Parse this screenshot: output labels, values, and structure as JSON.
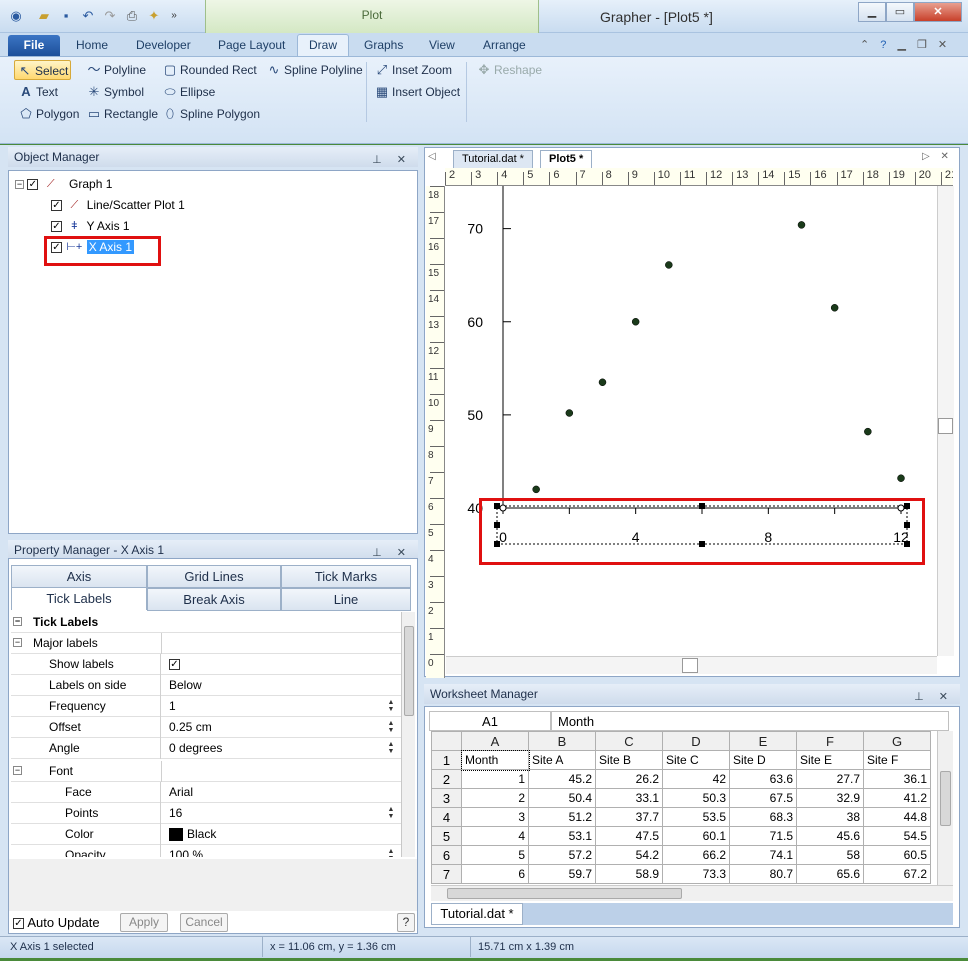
{
  "window": {
    "title": "Grapher - [Plot5 *]",
    "context_tab_group": "Plot"
  },
  "ribbon": {
    "tabs": [
      "File",
      "Home",
      "Developer",
      "Page Layout",
      "Draw",
      "Graphs",
      "View",
      "Arrange"
    ],
    "active_tab": "Draw",
    "draw_buttons": {
      "select": "Select",
      "polyline": "Polyline",
      "rounded_rect": "Rounded Rect",
      "spline_polyline": "Spline Polyline",
      "text": "Text",
      "symbol": "Symbol",
      "ellipse": "Ellipse",
      "polygon": "Polygon",
      "rectangle": "Rectangle",
      "spline_polygon": "Spline Polygon",
      "inset_zoom": "Inset Zoom",
      "insert_object": "Insert Object",
      "reshape": "Reshape"
    }
  },
  "object_manager": {
    "title": "Object Manager",
    "items": {
      "graph": "Graph 1",
      "plot": "Line/Scatter Plot 1",
      "yaxis": "Y Axis 1",
      "xaxis": "X Axis 1"
    }
  },
  "property_manager": {
    "title": "Property Manager - X Axis 1",
    "tabs_row1": [
      "Axis",
      "Grid Lines",
      "Tick Marks"
    ],
    "tabs_row2": [
      "Tick Labels",
      "Break Axis",
      "Line"
    ],
    "active_tab": "Tick Labels",
    "section": "Tick Labels",
    "major_labels": "Major labels",
    "rows": [
      {
        "label": "Show labels",
        "value": ""
      },
      {
        "label": "Labels on side",
        "value": "Below"
      },
      {
        "label": "Frequency",
        "value": "1"
      },
      {
        "label": "Offset",
        "value": "0.25 cm"
      },
      {
        "label": "Angle",
        "value": "0 degrees"
      }
    ],
    "font_section": "Font",
    "font_rows": [
      {
        "label": "Face",
        "value": "Arial"
      },
      {
        "label": "Points",
        "value": "16"
      },
      {
        "label": "Color",
        "value": "Black"
      },
      {
        "label": "Opacity",
        "value": "100 %"
      }
    ],
    "auto_update": "Auto Update",
    "apply": "Apply",
    "cancel": "Cancel",
    "help": "?"
  },
  "doc_tabs": [
    "Tutorial.dat *",
    "Plot5 *"
  ],
  "rulers": {
    "horizontal": [
      "2",
      "3",
      "4",
      "5",
      "6",
      "7",
      "8",
      "9",
      "10",
      "11",
      "12",
      "13",
      "14",
      "15",
      "16",
      "17",
      "18",
      "19",
      "20",
      "21"
    ],
    "vertical": [
      "18",
      "17",
      "16",
      "15",
      "14",
      "13",
      "12",
      "11",
      "10",
      "9",
      "8",
      "7",
      "6",
      "5",
      "4",
      "3",
      "2",
      "1",
      "0"
    ]
  },
  "chart_data": {
    "type": "scatter",
    "title": "",
    "xlabel": "",
    "ylabel": "",
    "xlim": [
      0,
      12
    ],
    "ylim": [
      40,
      72
    ],
    "x_ticks": [
      0,
      4,
      8,
      12
    ],
    "y_ticks": [
      70,
      60,
      50,
      40
    ],
    "series": [
      {
        "x": [
          1,
          2,
          3,
          4,
          5,
          9,
          10,
          11,
          12
        ],
        "y": [
          42,
          50.2,
          53.5,
          60,
          66.1,
          70.4,
          61.5,
          48.2,
          43.2
        ]
      }
    ],
    "marker_color": "#1a3a1a"
  },
  "worksheet": {
    "title": "Worksheet Manager",
    "cell_ref": "A1",
    "cell_value": "Month",
    "columns": [
      "A",
      "B",
      "C",
      "D",
      "E",
      "F",
      "G"
    ],
    "rows": [
      {
        "n": "1",
        "cells": [
          "Month",
          "Site A",
          "Site B",
          "Site C",
          "Site D",
          "Site E",
          "Site F"
        ]
      },
      {
        "n": "2",
        "cells": [
          "1",
          "45.2",
          "26.2",
          "42",
          "63.6",
          "27.7",
          "36.1"
        ]
      },
      {
        "n": "3",
        "cells": [
          "2",
          "50.4",
          "33.1",
          "50.3",
          "67.5",
          "32.9",
          "41.2"
        ]
      },
      {
        "n": "4",
        "cells": [
          "3",
          "51.2",
          "37.7",
          "53.5",
          "68.3",
          "38",
          "44.8"
        ]
      },
      {
        "n": "5",
        "cells": [
          "4",
          "53.1",
          "47.5",
          "60.1",
          "71.5",
          "45.6",
          "54.5"
        ]
      },
      {
        "n": "6",
        "cells": [
          "5",
          "57.2",
          "54.2",
          "66.2",
          "74.1",
          "58",
          "60.5"
        ]
      },
      {
        "n": "7",
        "cells": [
          "6",
          "59.7",
          "58.9",
          "73.3",
          "80.7",
          "65.6",
          "67.2"
        ]
      }
    ],
    "sheet_tab": "Tutorial.dat *"
  },
  "status": {
    "left": "X Axis 1 selected",
    "coords": "x = 11.06 cm, y = 1.36 cm",
    "size": "15.71 cm x 1.39 cm"
  }
}
